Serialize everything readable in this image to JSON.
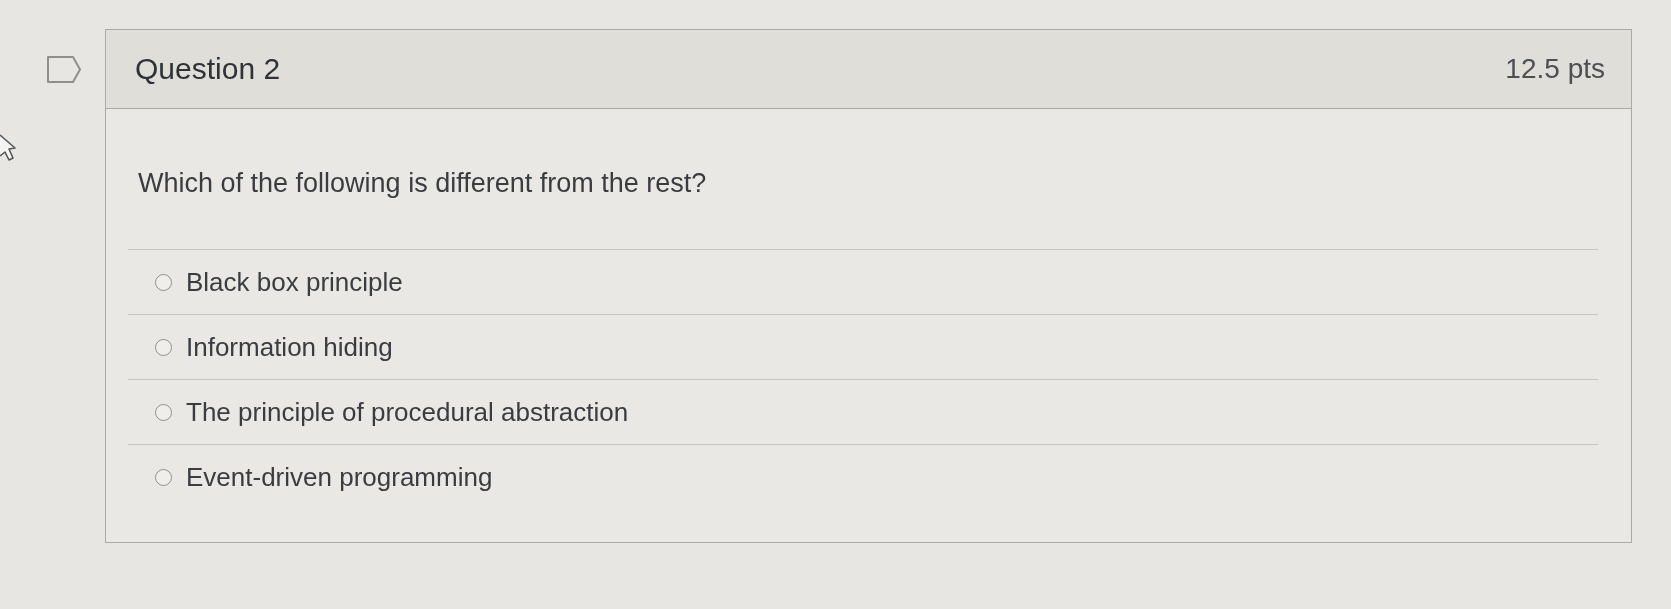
{
  "question": {
    "flagged": false,
    "title": "Question 2",
    "points": "12.5 pts",
    "prompt": "Which of the following is different from the rest?",
    "options": [
      {
        "label": "Black box principle",
        "selected": false
      },
      {
        "label": "Information hiding",
        "selected": false
      },
      {
        "label": "The principle of procedural abstraction",
        "selected": false
      },
      {
        "label": "Event-driven programming",
        "selected": false
      }
    ]
  }
}
